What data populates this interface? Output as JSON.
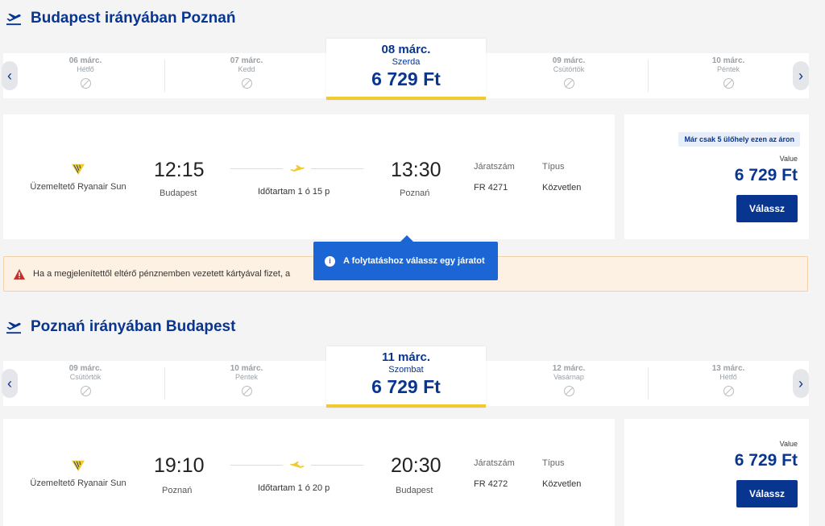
{
  "outbound": {
    "title": "Budapest irányában Poznań",
    "dates": [
      {
        "date": "06 márc.",
        "weekday": "Hétfő"
      },
      {
        "date": "07 márc.",
        "weekday": "Kedd"
      },
      {
        "date": "09 márc.",
        "weekday": "Csütörtök"
      },
      {
        "date": "10 márc.",
        "weekday": "Péntek"
      }
    ],
    "selected": {
      "date": "08 márc.",
      "weekday": "Szerda",
      "price": "6 729 Ft"
    },
    "flight": {
      "operator": "Üzemeltető Ryanair Sun",
      "dep_time": "12:15",
      "dep_city": "Budapest",
      "arr_time": "13:30",
      "arr_city": "Poznań",
      "duration": "Időtartam 1 ó 15 p",
      "flight_no_label": "Járatszám",
      "flight_no": "FR 4271",
      "type_label": "Típus",
      "type": "Közvetlen"
    },
    "fare": {
      "badge": "Már csak 5 ülőhely ezen az áron",
      "label": "Value",
      "price": "6 729 Ft",
      "button": "Válassz"
    }
  },
  "notice": {
    "warning": "Ha a megjelenítettől eltérő pénznemben vezetett kártyával fizet, a",
    "tooltip": "A folytatáshoz válassz egy járatot",
    "info_icon": "i"
  },
  "inbound": {
    "title": "Poznań irányában Budapest",
    "dates": [
      {
        "date": "09 márc.",
        "weekday": "Csütörtök"
      },
      {
        "date": "10 márc.",
        "weekday": "Péntek"
      },
      {
        "date": "12 márc.",
        "weekday": "Vasárnap"
      },
      {
        "date": "13 márc.",
        "weekday": "Hétfő"
      }
    ],
    "selected": {
      "date": "11 márc.",
      "weekday": "Szombat",
      "price": "6 729 Ft"
    },
    "flight": {
      "operator": "Üzemeltető Ryanair Sun",
      "dep_time": "19:10",
      "dep_city": "Poznań",
      "arr_time": "20:30",
      "arr_city": "Budapest",
      "duration": "Időtartam 1 ó 20 p",
      "flight_no_label": "Járatszám",
      "flight_no": "FR 4272",
      "type_label": "Típus",
      "type": "Közvetlen"
    },
    "fare": {
      "label": "Value",
      "price": "6 729 Ft",
      "button": "Válassz"
    }
  },
  "icons": {
    "prev": "‹",
    "next": "›"
  },
  "colors": {
    "brand": "#073590",
    "accent": "#f1c931",
    "info": "#1b65d4",
    "warning_bg": "#fdf1e4"
  }
}
